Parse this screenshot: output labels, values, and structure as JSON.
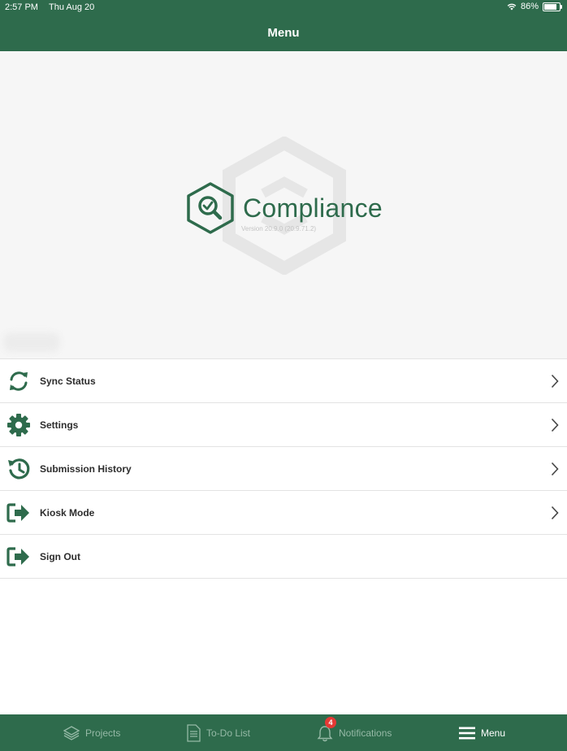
{
  "status_bar": {
    "time": "2:57 PM",
    "date": "Thu Aug 20",
    "battery": "86%",
    "battery_level": 0.86
  },
  "nav": {
    "title": "Menu"
  },
  "header": {
    "app_name": "Compliance",
    "version": "Version 20.9.0 (20.9.71.2)"
  },
  "menu": {
    "items": [
      {
        "label": "Sync Status",
        "icon": "sync-icon",
        "chevron": true
      },
      {
        "label": "Settings",
        "icon": "gear-icon",
        "chevron": true
      },
      {
        "label": "Submission History",
        "icon": "history-icon",
        "chevron": true
      },
      {
        "label": "Kiosk Mode",
        "icon": "kiosk-icon",
        "chevron": true
      },
      {
        "label": "Sign Out",
        "icon": "sign-out-icon",
        "chevron": false
      }
    ]
  },
  "tab_bar": {
    "tabs": [
      {
        "label": "Projects",
        "icon": "layers-icon",
        "active": false
      },
      {
        "label": "To-Do List",
        "icon": "document-icon",
        "active": false
      },
      {
        "label": "Notifications",
        "icon": "bell-icon",
        "active": false,
        "badge": "4"
      },
      {
        "label": "Menu",
        "icon": "hamburger-icon",
        "active": true
      }
    ]
  },
  "colors": {
    "primary": "#2e6b4c",
    "badge": "#e53935",
    "inactive_tab": "#95b9a6"
  }
}
